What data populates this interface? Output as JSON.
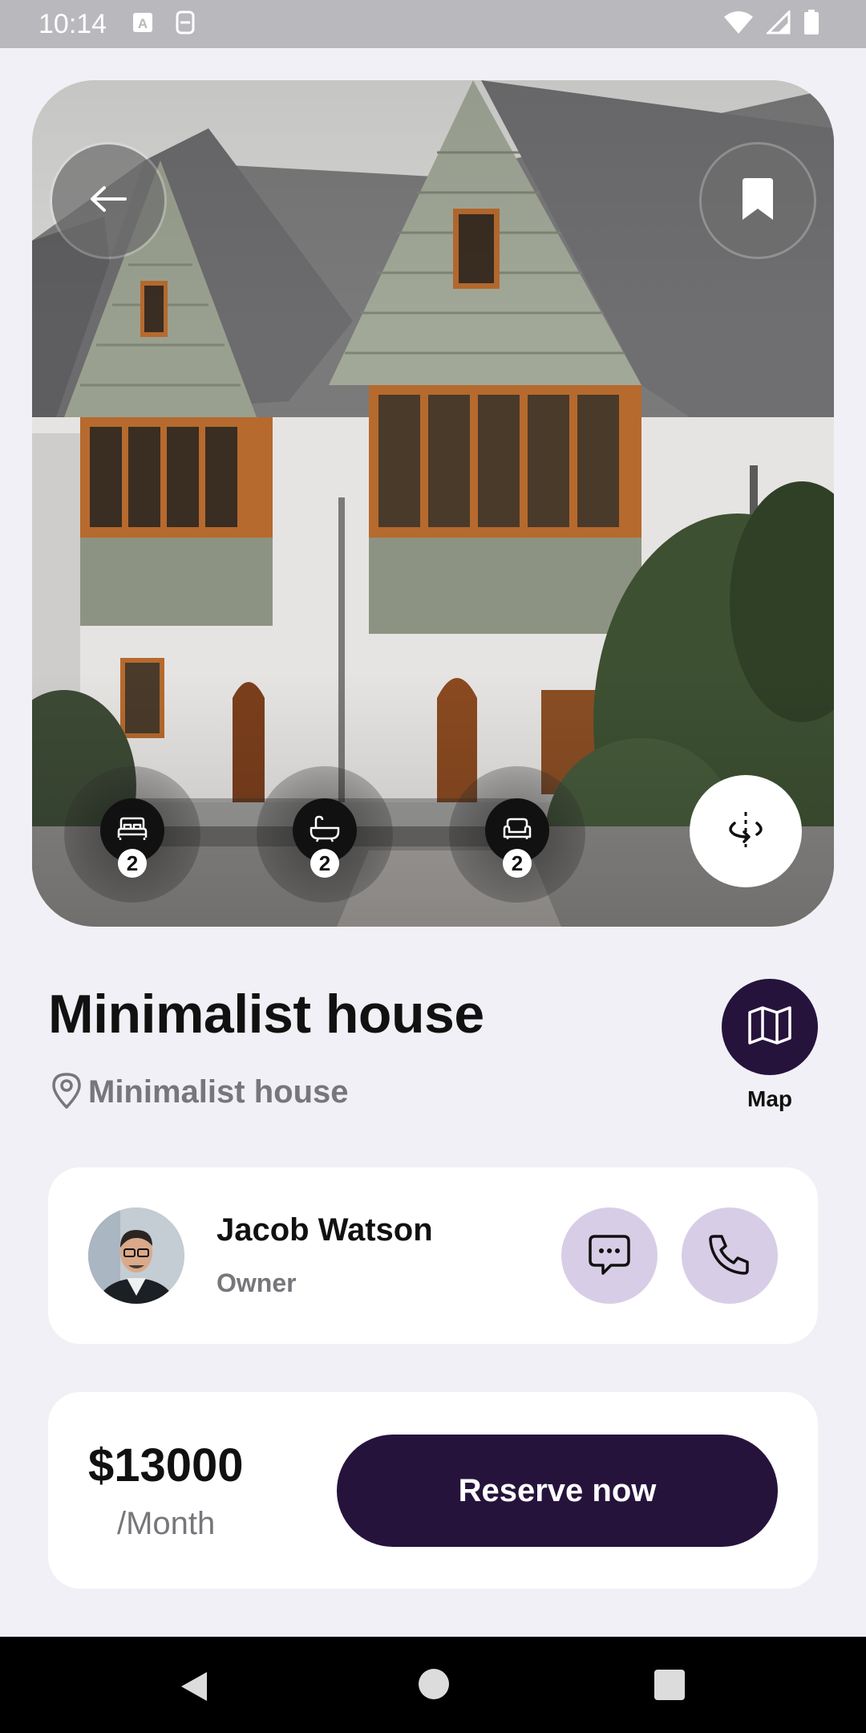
{
  "status_bar": {
    "time": "10:14"
  },
  "property": {
    "title": "Minimalist house",
    "location": "Minimalist house",
    "features": [
      {
        "icon": "bed-icon",
        "count": "2"
      },
      {
        "icon": "bathtub-icon",
        "count": "2"
      },
      {
        "icon": "sofa-icon",
        "count": "2"
      }
    ],
    "map_label": "Map"
  },
  "owner": {
    "name": "Jacob Watson",
    "role": "Owner"
  },
  "pricing": {
    "price": "$13000",
    "period": "/Month",
    "reserve_label": "Reserve now"
  },
  "colors": {
    "primary": "#26133c",
    "contact_bg": "#d8cde6",
    "background": "#f1f0f6"
  }
}
